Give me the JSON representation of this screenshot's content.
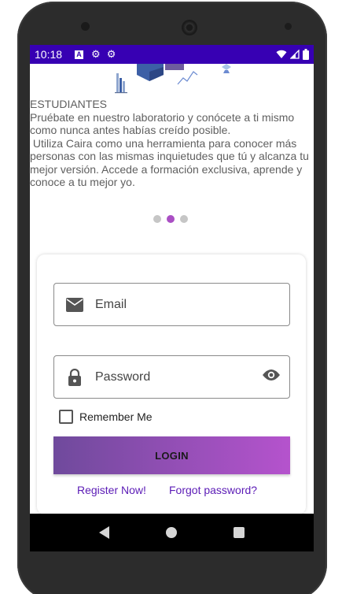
{
  "status_bar": {
    "time": "10:18",
    "icons": [
      "a-notification-icon",
      "settings-icon",
      "settings-icon",
      "wifi-icon",
      "signal-icon",
      "battery-icon"
    ]
  },
  "intro": {
    "heading": "ESTUDIANTES",
    "paragraph1": "Pruébate en nuestro laboratorio y conócete a ti mismo como nunca antes habías creído posible.",
    "paragraph2": " Utiliza Caira como una herramienta para conocer más personas con las mismas inquietudes que tú y alcanza tu mejor versión. Accede a formación exclusiva, aprende y conoce a tu mejor yo."
  },
  "pager": {
    "count": 3,
    "active_index": 1
  },
  "login_form": {
    "email_label": "Email",
    "password_label": "Password",
    "remember_label": "Remember Me",
    "remember_checked": false,
    "login_button": "LOGIN",
    "register_link": "Register Now!",
    "forgot_link": "Forgot password?"
  },
  "colors": {
    "status_bar": "#3700b3",
    "accent": "#aa4fc4",
    "button_gradient_start": "#6f4a9c",
    "button_gradient_end": "#b553cd",
    "link": "#5b1bb6"
  }
}
